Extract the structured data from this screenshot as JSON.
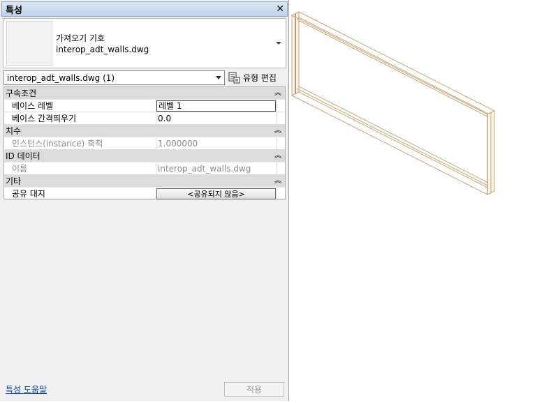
{
  "panel": {
    "title": "특성",
    "close_glyph": "✕"
  },
  "type_selector": {
    "family": "가져오기 기호",
    "type": "interop_adt_walls.dwg"
  },
  "instance_filter": {
    "value": "interop_adt_walls.dwg (1)"
  },
  "edit_type": {
    "label": "유형 편집"
  },
  "groups": {
    "constraints": {
      "label": "구속조건",
      "rows": {
        "base_level": {
          "name": "베이스 레벨",
          "value": "레벨 1"
        },
        "base_offset": {
          "name": "베이스 간격띄우기",
          "value": "0.0"
        }
      }
    },
    "dimensions": {
      "label": "치수",
      "rows": {
        "instance_scale": {
          "name": "인스턴스(instance) 축척",
          "value": "1.000000"
        }
      }
    },
    "identity": {
      "label": "ID 데이터",
      "rows": {
        "name": {
          "name": "이름",
          "value": "interop_adt_walls.dwg"
        }
      }
    },
    "other": {
      "label": "기타",
      "rows": {
        "shared_site": {
          "name": "공유 대지",
          "value": "<공유되지 않음>"
        }
      }
    }
  },
  "footer": {
    "help_link": "특성 도움말",
    "apply_label": "적용"
  }
}
